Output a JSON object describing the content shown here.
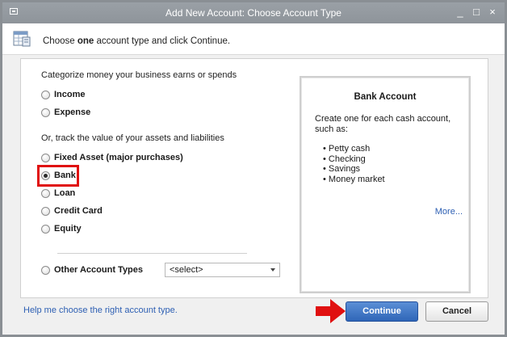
{
  "window": {
    "title": "Add New Account: Choose Account Type",
    "minimize_glyph": "_",
    "maximize_glyph": "□",
    "close_glyph": "×"
  },
  "header": {
    "text_before": "Choose ",
    "text_bold": "one",
    "text_after": " account type and click Continue.",
    "icon": "chart-of-accounts-icon"
  },
  "categorize": {
    "label": "Categorize money your business earns or spends",
    "options": [
      {
        "label": "Income",
        "selected": false
      },
      {
        "label": "Expense",
        "selected": false
      }
    ]
  },
  "track": {
    "label": "Or, track the value of your assets and liabilities",
    "options": [
      {
        "label": "Fixed Asset (major purchases)",
        "selected": false
      },
      {
        "label": "Bank",
        "selected": true
      },
      {
        "label": "Loan",
        "selected": false
      },
      {
        "label": "Credit Card",
        "selected": false
      },
      {
        "label": "Equity",
        "selected": false
      }
    ]
  },
  "other": {
    "label": "Other Account Types",
    "select_value": "<select>"
  },
  "info": {
    "title": "Bank Account",
    "description": "Create one for each cash account, such as:",
    "items": [
      "Petty cash",
      "Checking",
      "Savings",
      "Money market"
    ],
    "more_link": "More..."
  },
  "footer": {
    "help_link": "Help me choose the right account type.",
    "continue_label": "Continue",
    "cancel_label": "Cancel"
  },
  "colors": {
    "highlight": "#e01010",
    "primary_button": "#2f66b8",
    "link": "#2d5fb3"
  }
}
